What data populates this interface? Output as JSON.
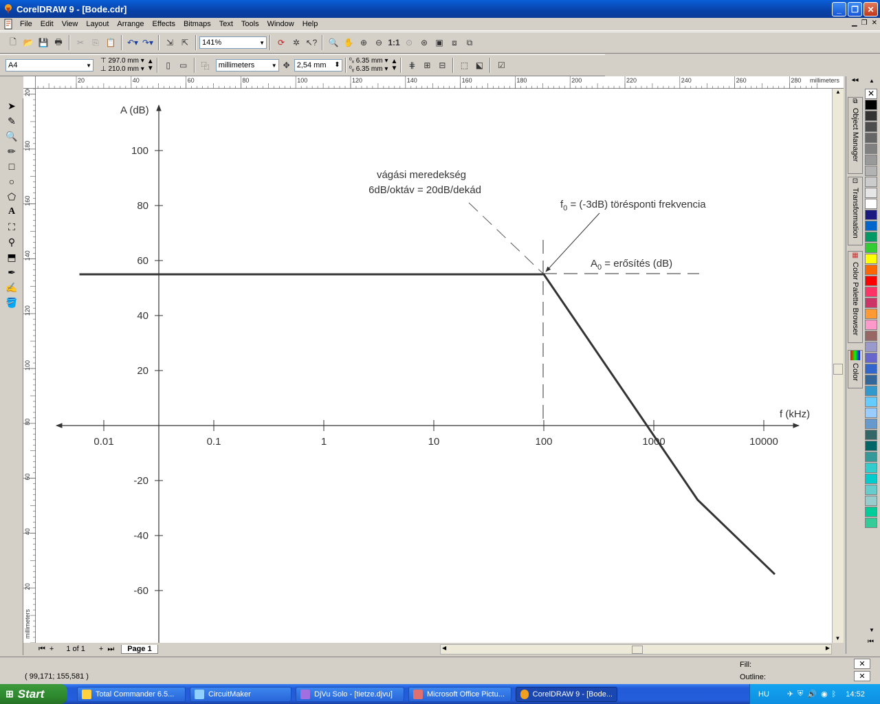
{
  "window": {
    "title": "CorelDRAW 9 - [Bode.cdr]"
  },
  "menu": [
    "File",
    "Edit",
    "View",
    "Layout",
    "Arrange",
    "Effects",
    "Bitmaps",
    "Text",
    "Tools",
    "Window",
    "Help"
  ],
  "toolbar": {
    "zoom": "141%"
  },
  "propertybar": {
    "paper": "A4",
    "width": "297.0 mm",
    "height": "210.0 mm",
    "units": "millimeters",
    "nudge": "2,54 mm",
    "dup_x": "6.35 mm",
    "dup_y": "6.35 mm"
  },
  "ruler": {
    "h_ticks": [
      "20",
      "40",
      "60",
      "80",
      "100",
      "120",
      "140",
      "160",
      "180",
      "200",
      "220",
      "240",
      "260",
      "280"
    ],
    "h_unit": "millimeters",
    "v_ticks": [
      "200",
      "180",
      "160",
      "140",
      "120",
      "100",
      "80",
      "60",
      "40",
      "20"
    ],
    "v_unit": "millimeters"
  },
  "dockers": [
    "Object Manager",
    "Transformation",
    "Color Palette Browser",
    "Color"
  ],
  "palette": [
    "#000000",
    "#333333",
    "#4d4d4d",
    "#666666",
    "#808080",
    "#999999",
    "#b3b3b3",
    "#cccccc",
    "#e6e6e6",
    "#ffffff",
    "#1a1a80",
    "#0066cc",
    "#009966",
    "#33cc33",
    "#ffff00",
    "#ff6600",
    "#ff0000",
    "#ff3366",
    "#cc3366",
    "#ff9933",
    "#ff99cc",
    "#996666",
    "#9999cc",
    "#6666cc",
    "#3366cc",
    "#336699",
    "#3399cc",
    "#66ccff",
    "#99ccff",
    "#6699cc",
    "#336666",
    "#006666",
    "#339999",
    "#33cccc",
    "#00cccc",
    "#66cccc",
    "#99cccc",
    "#00cc99",
    "#33cc99"
  ],
  "chart_data": {
    "type": "line",
    "ylabel": "A (dB)",
    "xlabel": "f (kHz)",
    "x_ticks": [
      "0.01",
      "0.1",
      "1",
      "10",
      "100",
      "1000",
      "10000"
    ],
    "y_ticks": [
      "100",
      "80",
      "60",
      "40",
      "20",
      "-20",
      "-40",
      "-60"
    ],
    "x_scale": "log",
    "series": [
      {
        "x": [
          0.006,
          100,
          2500,
          15000
        ],
        "y": [
          55,
          55,
          -27,
          -57
        ]
      }
    ],
    "annotations": {
      "slope_line1": "vágási meredekség",
      "slope_line2": "6dB/oktáv = 20dB/dekád",
      "f0_label": "f",
      "f0_sub": "0",
      "f0_rest": " = (-3dB) törésponti frekvencia",
      "a0_label": "A",
      "a0_sub": "0",
      "a0_rest": " = erősítés (dB)"
    }
  },
  "pagebar": {
    "count": "1 of 1",
    "page": "Page 1"
  },
  "status": {
    "coords": "( 99,171; 155,581 )",
    "fill": "Fill:",
    "outline": "Outline:"
  },
  "taskbar": {
    "start": "Start",
    "tasks": [
      "Total Commander 6.5...",
      "CircuitMaker",
      "DjVu Solo - [tietze.djvu]",
      "Microsoft Office Pictu...",
      "CorelDRAW 9 - [Bode..."
    ],
    "lang": "HU",
    "time": "14:52"
  }
}
